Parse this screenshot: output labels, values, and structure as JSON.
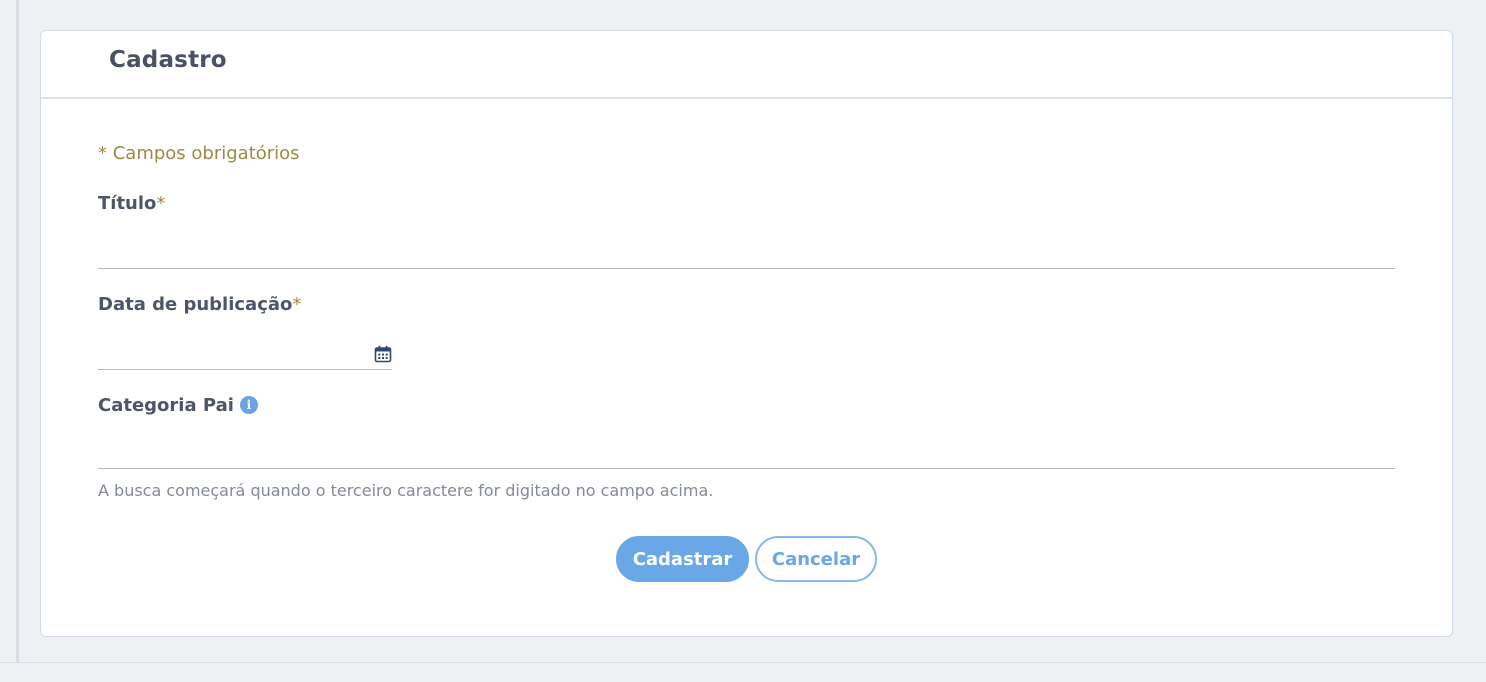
{
  "form": {
    "title": "Cadastro",
    "required_note": "* Campos obrigatórios",
    "fields": {
      "titulo": {
        "label": "Título",
        "required_mark": "*",
        "value": ""
      },
      "data_publicacao": {
        "label": "Data de publicação",
        "required_mark": "*",
        "value": ""
      },
      "categoria_pai": {
        "label": "Categoria Pai",
        "value": "",
        "hint": "A busca começará quando o terceiro caractere for digitado no campo acima."
      }
    },
    "icons": {
      "calendar": "calendar-icon",
      "info": "info-icon",
      "info_glyph": "i"
    }
  },
  "actions": {
    "submit_label": "Cadastrar",
    "cancel_label": "Cancelar"
  },
  "colors": {
    "accent": "#6aa7e7",
    "required": "#a08845",
    "background": "#edf1f4"
  }
}
